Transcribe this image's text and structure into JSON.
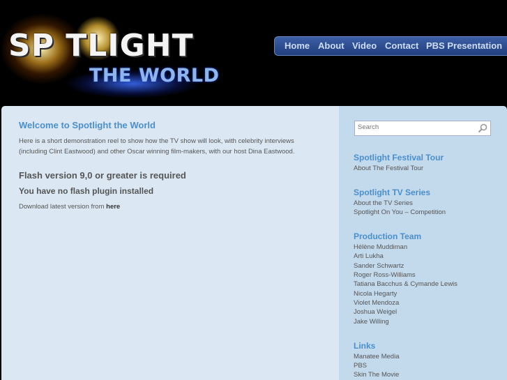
{
  "logo": {
    "word1": "SP  TLIGHT",
    "word2": "THE WORLD"
  },
  "nav": [
    "Home",
    "About",
    "Video",
    "Contact",
    "PBS Presentation"
  ],
  "main": {
    "title": "Welcome to Spotlight the World",
    "intro": "Here is a short demonstration reel to show how the TV show will look, with celebrity interviews (including Clint Eastwood) and other Oscar winning film-makers, with our host Dina Eastwood.",
    "flash_required": "Flash version 9,0 or greater is required",
    "no_flash": "You have no flash plugin installed",
    "download_prefix": "Download latest version from ",
    "download_link": "here"
  },
  "sidebar": {
    "search_placeholder": "Search",
    "sections": [
      {
        "title": "Spotlight Festival Tour",
        "links": [
          "About The Festival Tour"
        ]
      },
      {
        "title": "Spotlight TV Series",
        "links": [
          "About the TV Series",
          "Spotlight On You – Competition"
        ]
      },
      {
        "title": "Production Team",
        "links": [
          "Hélène Muddiman",
          "Arti Lukha",
          "Sander Schwartz",
          "Roger Ross-Williams",
          "Tatiana Bacchus & Cymande Lewis",
          "Nicola Hegarty",
          "Violet Mendoza",
          "Joshua Weigel",
          "Jake Willing"
        ]
      },
      {
        "title": "Links",
        "links": [
          "Manatee Media",
          "PBS",
          "Skin The Movie"
        ]
      }
    ]
  }
}
